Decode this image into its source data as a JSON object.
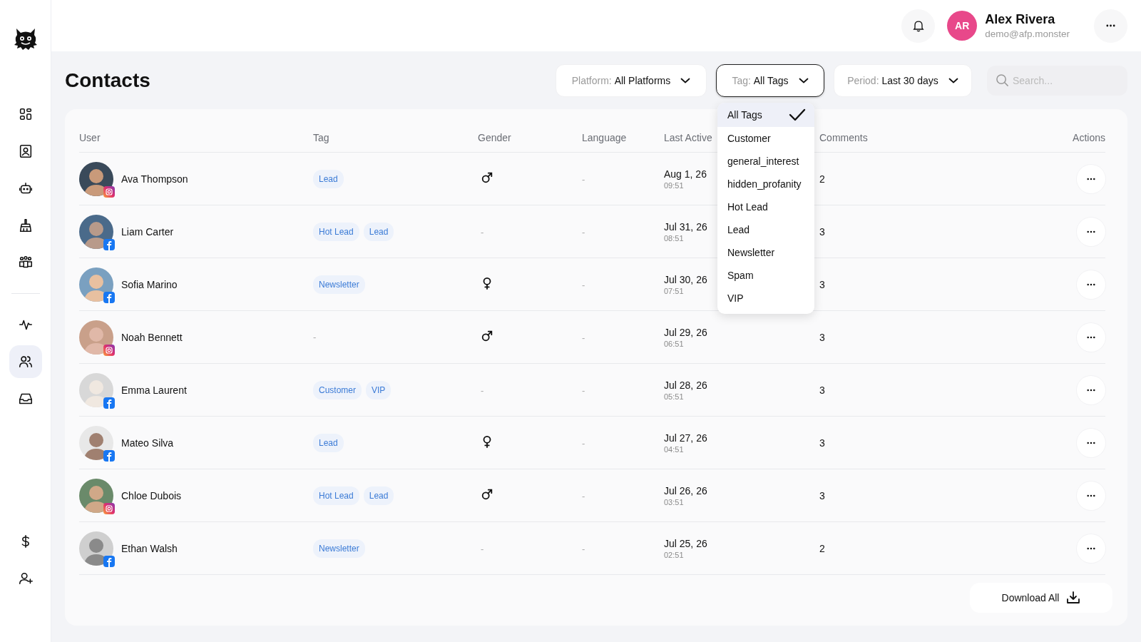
{
  "sidebar": {
    "nav": [
      {
        "selected": false
      },
      {
        "selected": false
      },
      {
        "selected": false
      },
      {
        "selected": false
      },
      {
        "selected": false
      },
      {
        "selected": false
      },
      {
        "selected": true
      },
      {
        "selected": false
      }
    ],
    "bottom_nav": [
      {
        "selected": false
      },
      {
        "selected": false
      }
    ]
  },
  "header": {
    "user": {
      "initials": "AR",
      "color": "#e8488a",
      "name": "Alex Rivera",
      "email": "demo@afp.monster"
    }
  },
  "page": {
    "title": "Contacts"
  },
  "filters": [
    {
      "label": "Platform:",
      "value": "All Platforms",
      "open": false
    },
    {
      "label": "Tag:",
      "value": "All Tags",
      "open": true
    },
    {
      "label": "Period:",
      "value": "Last 30 days",
      "open": false
    }
  ],
  "search": {
    "placeholder": "Search..."
  },
  "tag_menu": [
    {
      "label": "All Tags",
      "selected": true
    },
    {
      "label": "Customer",
      "selected": false
    },
    {
      "label": "general_interest",
      "selected": false
    },
    {
      "label": "hidden_profanity",
      "selected": false
    },
    {
      "label": "Hot Lead",
      "selected": false
    },
    {
      "label": "Lead",
      "selected": false
    },
    {
      "label": "Newsletter",
      "selected": false
    },
    {
      "label": "Spam",
      "selected": false
    },
    {
      "label": "VIP",
      "selected": false
    }
  ],
  "table": {
    "columns": [
      "User",
      "Tag",
      "Gender",
      "Language",
      "Last Active",
      "Comments",
      "Actions"
    ],
    "rows": [
      {
        "name": "Ava Thompson",
        "platform": {
          "kind": "instagram"
        },
        "tags": [
          "Lead"
        ],
        "gender": {
          "kind": "male"
        },
        "language": "-",
        "date": "Aug 1, 26",
        "time": "09:51",
        "comments": "2"
      },
      {
        "name": "Liam Carter",
        "platform": {
          "kind": "facebook"
        },
        "tags": [
          "Hot Lead",
          "Lead"
        ],
        "gender": {
          "kind": "text",
          "text": "-"
        },
        "language": "-",
        "date": "Jul 31, 26",
        "time": "08:51",
        "comments": "3"
      },
      {
        "name": "Sofia Marino",
        "platform": {
          "kind": "facebook"
        },
        "tags": [
          "Newsletter"
        ],
        "gender": {
          "kind": "female"
        },
        "language": "-",
        "date": "Jul 30, 26",
        "time": "07:51",
        "comments": "3"
      },
      {
        "name": "Noah Bennett",
        "platform": {
          "kind": "instagram"
        },
        "no_tag": "-",
        "gender": {
          "kind": "male"
        },
        "language": "-",
        "date": "Jul 29, 26",
        "time": "06:51",
        "comments": "3"
      },
      {
        "name": "Emma Laurent",
        "platform": {
          "kind": "facebook"
        },
        "tags": [
          "Customer",
          "VIP"
        ],
        "gender": {
          "kind": "text",
          "text": "-"
        },
        "language": "-",
        "date": "Jul 28, 26",
        "time": "05:51",
        "comments": "3"
      },
      {
        "name": "Mateo Silva",
        "platform": {
          "kind": "facebook"
        },
        "tags": [
          "Lead"
        ],
        "gender": {
          "kind": "female"
        },
        "language": "-",
        "date": "Jul 27, 26",
        "time": "04:51",
        "comments": "3"
      },
      {
        "name": "Chloe Dubois",
        "platform": {
          "kind": "instagram"
        },
        "tags": [
          "Hot Lead",
          "Lead"
        ],
        "gender": {
          "kind": "male"
        },
        "language": "-",
        "date": "Jul 26, 26",
        "time": "03:51",
        "comments": "3"
      },
      {
        "name": "Ethan Walsh",
        "platform": {
          "kind": "facebook"
        },
        "tags": [
          "Newsletter"
        ],
        "gender": {
          "kind": "text",
          "text": "-"
        },
        "language": "-",
        "date": "Jul 25, 26",
        "time": "02:51",
        "comments": "2"
      }
    ]
  },
  "download_button": {
    "label": "Download All"
  }
}
